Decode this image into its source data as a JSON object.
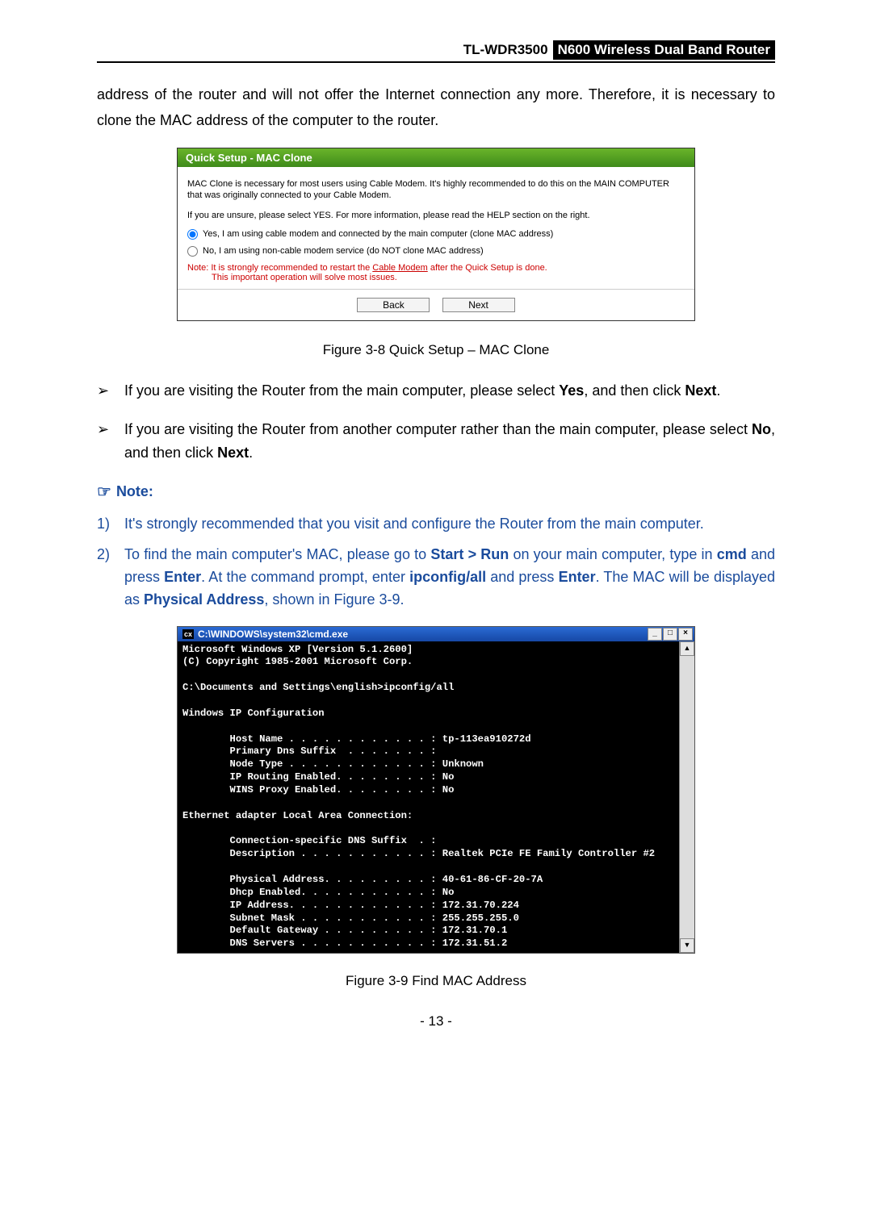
{
  "header": {
    "model": "TL-WDR3500",
    "product": "N600 Wireless Dual Band Router"
  },
  "intro": "address of the router and will not offer the Internet connection any more. Therefore, it is necessary to clone the MAC address of the computer to the router.",
  "quick_setup": {
    "title": "Quick Setup - MAC Clone",
    "desc1": "MAC Clone is necessary for most users using Cable Modem. It's highly recommended to do this on the MAIN COMPUTER that was originally connected to your Cable Modem.",
    "desc2": "If you are unsure, please select YES. For more information, please read the HELP section on the right.",
    "opt_yes": "Yes, I am using cable modem and connected by the main computer (clone MAC address)",
    "opt_no": "No, I am using non-cable modem service (do NOT clone MAC address)",
    "note_prefix": "Note:",
    "note_text": " It is strongly recommended to restart the ",
    "note_under": "Cable Modem",
    "note_after": " after the Quick Setup is done.",
    "note_line2": "This important operation will solve most issues.",
    "back": "Back",
    "next": "Next"
  },
  "fig1": "Figure 3-8 Quick Setup – MAC Clone",
  "bullets": [
    {
      "pre": "If you are visiting the Router from the main computer, please select ",
      "b1": "Yes",
      "mid": ", and then click ",
      "b2": "Next",
      "post": "."
    },
    {
      "pre": "If you are visiting the Router from another computer rather than the main computer, please select ",
      "b1": "No",
      "mid": ", and then click ",
      "b2": "Next",
      "post": "."
    }
  ],
  "note_label": "Note:",
  "notes": [
    "It's strongly recommended that you visit and configure the Router from the main computer.",
    {
      "pre": "To find the main computer's MAC, please go to ",
      "b1": "Start > Run",
      "t1": " on your main computer, type in ",
      "b2": "cmd",
      "t2": " and press ",
      "b3": "Enter",
      "t3": ". At the command prompt, enter ",
      "b4": "ipconfig/all",
      "t4": " and press ",
      "b5": "Enter",
      "t5": ". The MAC will be displayed as ",
      "b6": "Physical Address",
      "t6": ", shown in Figure 3-9."
    }
  ],
  "cmd": {
    "title": "C:\\WINDOWS\\system32\\cmd.exe",
    "body": "Microsoft Windows XP [Version 5.1.2600]\n(C) Copyright 1985-2001 Microsoft Corp.\n\nC:\\Documents and Settings\\english>ipconfig/all\n\nWindows IP Configuration\n\n        Host Name . . . . . . . . . . . . : tp-113ea910272d\n        Primary Dns Suffix  . . . . . . . :\n        Node Type . . . . . . . . . . . . : Unknown\n        IP Routing Enabled. . . . . . . . : No\n        WINS Proxy Enabled. . . . . . . . : No\n\nEthernet adapter Local Area Connection:\n\n        Connection-specific DNS Suffix  . :\n        Description . . . . . . . . . . . : Realtek PCIe FE Family Controller #2\n\n        Physical Address. . . . . . . . . : 40-61-86-CF-20-7A\n        Dhcp Enabled. . . . . . . . . . . : No\n        IP Address. . . . . . . . . . . . : 172.31.70.224\n        Subnet Mask . . . . . . . . . . . : 255.255.255.0\n        Default Gateway . . . . . . . . . : 172.31.70.1\n        DNS Servers . . . . . . . . . . . : 172.31.51.2"
  },
  "fig2": "Figure 3-9 Find MAC Address",
  "page_number": "- 13 -",
  "chart_data": {
    "type": "table",
    "title": "ipconfig/all output",
    "rows": [
      [
        "Host Name",
        "tp-113ea910272d"
      ],
      [
        "Primary Dns Suffix",
        ""
      ],
      [
        "Node Type",
        "Unknown"
      ],
      [
        "IP Routing Enabled",
        "No"
      ],
      [
        "WINS Proxy Enabled",
        "No"
      ],
      [
        "Connection-specific DNS Suffix",
        ""
      ],
      [
        "Description",
        "Realtek PCIe FE Family Controller #2"
      ],
      [
        "Physical Address",
        "40-61-86-CF-20-7A"
      ],
      [
        "Dhcp Enabled",
        "No"
      ],
      [
        "IP Address",
        "172.31.70.224"
      ],
      [
        "Subnet Mask",
        "255.255.255.0"
      ],
      [
        "Default Gateway",
        "172.31.70.1"
      ],
      [
        "DNS Servers",
        "172.31.51.2"
      ]
    ]
  }
}
